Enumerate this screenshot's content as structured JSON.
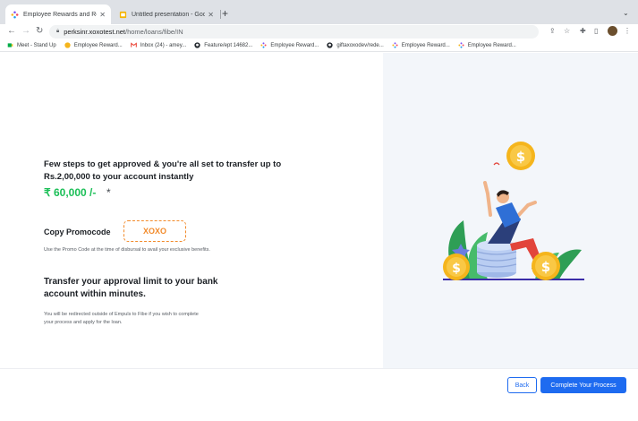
{
  "browser": {
    "tabs": [
      {
        "title": "Employee Rewards and Recog",
        "active": true
      },
      {
        "title": "Untitled presentation - Google",
        "active": false
      }
    ],
    "url_host": "perksinr.xoxotest.net",
    "url_path": "/home/loans/fibe/IN",
    "bookmarks": [
      {
        "label": "Meet - Stand Up",
        "icon": "meet-icon"
      },
      {
        "label": "Employee Reward...",
        "icon": "emoji-icon"
      },
      {
        "label": "Inbox (24) - amey...",
        "icon": "gmail-icon"
      },
      {
        "label": "Feature/ept 14682...",
        "icon": "github-icon"
      },
      {
        "label": "Employee Reward...",
        "icon": "xoxo-icon"
      },
      {
        "label": "giftaxoxodev/rede...",
        "icon": "github-icon"
      },
      {
        "label": "Employee Reward...",
        "icon": "xoxo-icon"
      },
      {
        "label": "Employee Reward...",
        "icon": "xoxo-icon"
      }
    ]
  },
  "content": {
    "headline": "Few steps to get approved & you're all set to transfer up to Rs.2,00,000 to your account instantly",
    "amount": "₹ 60,000 /-",
    "asterisk": "*",
    "promo_label": "Copy Promocode",
    "promo_code": "XOXO",
    "promo_note": "Use the Promo Code at the time of disbursal to avail your exclusive benefits.",
    "transfer_title": "Transfer your approval limit to your bank account within minutes.",
    "redirect_note": "You will be redirected outside of Empuls to Fibe if you wish to complete your process and apply for the loan."
  },
  "footer": {
    "back_label": "Back",
    "complete_label": "Complete Your Process"
  },
  "colors": {
    "accent_blue": "#1e6bf0",
    "amount_green": "#1bbf57",
    "promo_orange": "#f28a2a",
    "coin_yellow": "#f5b51c"
  }
}
